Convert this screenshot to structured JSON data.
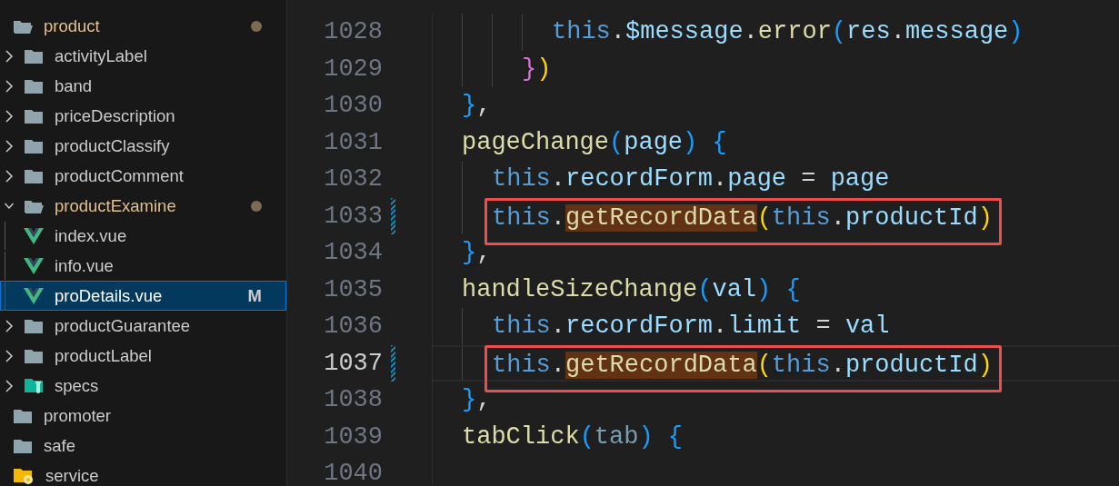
{
  "explorer": {
    "items": [
      {
        "label": "product",
        "kind": "folder",
        "expanded": true,
        "modified": true,
        "selected": false,
        "children": [
          {
            "label": "activityLabel",
            "kind": "folder",
            "expanded": false,
            "modified": false,
            "selected": false
          },
          {
            "label": "band",
            "kind": "folder",
            "expanded": false,
            "modified": false,
            "selected": false
          },
          {
            "label": "priceDescription",
            "kind": "folder",
            "expanded": false,
            "modified": false,
            "selected": false
          },
          {
            "label": "productClassify",
            "kind": "folder",
            "expanded": false,
            "modified": false,
            "selected": false
          },
          {
            "label": "productComment",
            "kind": "folder",
            "expanded": false,
            "modified": false,
            "selected": false
          },
          {
            "label": "productExamine",
            "kind": "folder",
            "expanded": true,
            "modified": true,
            "selected": false,
            "children": [
              {
                "label": "index.vue",
                "kind": "vue",
                "modified": false,
                "selected": false
              },
              {
                "label": "info.vue",
                "kind": "vue",
                "modified": false,
                "selected": false
              },
              {
                "label": "proDetails.vue",
                "kind": "vue",
                "modified": false,
                "selected": true,
                "badge": "M"
              }
            ]
          },
          {
            "label": "productGuarantee",
            "kind": "folder",
            "expanded": false,
            "modified": false,
            "selected": false
          },
          {
            "label": "productLabel",
            "kind": "folder",
            "expanded": false,
            "modified": false,
            "selected": false
          },
          {
            "label": "specs",
            "kind": "folder-test",
            "expanded": false,
            "modified": false,
            "selected": false
          }
        ]
      },
      {
        "label": "promoter",
        "kind": "folder",
        "expanded": false,
        "modified": false,
        "selected": false
      },
      {
        "label": "safe",
        "kind": "folder",
        "expanded": false,
        "modified": false,
        "selected": false
      },
      {
        "label": "service",
        "kind": "folder-service",
        "expanded": false,
        "modified": false,
        "selected": false
      }
    ]
  },
  "editor": {
    "lines": [
      {
        "number": "1028",
        "current": false,
        "changed": false,
        "boxed": false,
        "tokens": [
          {
            "text": "      this",
            "kind": "keyword"
          },
          {
            "text": ".",
            "kind": "punct"
          },
          {
            "text": "$message",
            "kind": "prop"
          },
          {
            "text": ".",
            "kind": "punct"
          },
          {
            "text": "error",
            "kind": "func"
          },
          {
            "text": "(",
            "kind": "bracket3"
          },
          {
            "text": "res",
            "kind": "prop"
          },
          {
            "text": ".",
            "kind": "punct"
          },
          {
            "text": "message",
            "kind": "prop"
          },
          {
            "text": ")",
            "kind": "bracket3"
          }
        ]
      },
      {
        "number": "1029",
        "current": false,
        "changed": false,
        "boxed": false,
        "tokens": [
          {
            "text": "    }",
            "kind": "bracket2"
          },
          {
            "text": ")",
            "kind": "bracket1"
          }
        ]
      },
      {
        "number": "1030",
        "current": false,
        "changed": false,
        "boxed": false,
        "tokens": [
          {
            "text": "}",
            "kind": "bracket3"
          },
          {
            "text": ",",
            "kind": "punct"
          }
        ]
      },
      {
        "number": "1031",
        "current": false,
        "changed": false,
        "boxed": false,
        "tokens": [
          {
            "text": "pageChange",
            "kind": "func"
          },
          {
            "text": "(",
            "kind": "bracket3"
          },
          {
            "text": "page",
            "kind": "prop"
          },
          {
            "text": ")",
            "kind": "bracket3"
          },
          {
            "text": " {",
            "kind": "bracket3"
          }
        ]
      },
      {
        "number": "1032",
        "current": false,
        "changed": false,
        "boxed": false,
        "tokens": [
          {
            "text": "  this",
            "kind": "keyword"
          },
          {
            "text": ".",
            "kind": "punct"
          },
          {
            "text": "recordForm",
            "kind": "prop"
          },
          {
            "text": ".",
            "kind": "punct"
          },
          {
            "text": "page",
            "kind": "prop"
          },
          {
            "text": " = ",
            "kind": "punct"
          },
          {
            "text": "page",
            "kind": "prop"
          }
        ]
      },
      {
        "number": "1033",
        "current": false,
        "changed": true,
        "boxed": true,
        "tokens": [
          {
            "text": "  this",
            "kind": "keyword"
          },
          {
            "text": ".",
            "kind": "punct"
          },
          {
            "text": "getRecordData",
            "kind": "func-match"
          },
          {
            "text": "(",
            "kind": "bracket1"
          },
          {
            "text": "this",
            "kind": "keyword"
          },
          {
            "text": ".",
            "kind": "punct"
          },
          {
            "text": "productId",
            "kind": "prop"
          },
          {
            "text": ")",
            "kind": "bracket1"
          }
        ]
      },
      {
        "number": "1034",
        "current": false,
        "changed": false,
        "boxed": false,
        "tokens": [
          {
            "text": "}",
            "kind": "bracket3"
          },
          {
            "text": ",",
            "kind": "punct"
          }
        ]
      },
      {
        "number": "1035",
        "current": false,
        "changed": false,
        "boxed": false,
        "tokens": [
          {
            "text": "handleSizeChange",
            "kind": "func"
          },
          {
            "text": "(",
            "kind": "bracket3"
          },
          {
            "text": "val",
            "kind": "prop"
          },
          {
            "text": ")",
            "kind": "bracket3"
          },
          {
            "text": " {",
            "kind": "bracket3"
          }
        ]
      },
      {
        "number": "1036",
        "current": false,
        "changed": false,
        "boxed": false,
        "tokens": [
          {
            "text": "  this",
            "kind": "keyword"
          },
          {
            "text": ".",
            "kind": "punct"
          },
          {
            "text": "recordForm",
            "kind": "prop"
          },
          {
            "text": ".",
            "kind": "punct"
          },
          {
            "text": "limit",
            "kind": "prop"
          },
          {
            "text": " = ",
            "kind": "punct"
          },
          {
            "text": "val",
            "kind": "prop"
          }
        ]
      },
      {
        "number": "1037",
        "current": true,
        "changed": true,
        "boxed": true,
        "tokens": [
          {
            "text": "  this",
            "kind": "keyword"
          },
          {
            "text": ".",
            "kind": "punct"
          },
          {
            "text": "getRecordData",
            "kind": "func-match"
          },
          {
            "text": "(",
            "kind": "bracket1"
          },
          {
            "text": "this",
            "kind": "keyword"
          },
          {
            "text": ".",
            "kind": "punct"
          },
          {
            "text": "productId",
            "kind": "prop"
          },
          {
            "text": ")",
            "kind": "bracket1"
          }
        ]
      },
      {
        "number": "1038",
        "current": false,
        "changed": false,
        "boxed": false,
        "tokens": [
          {
            "text": "}",
            "kind": "bracket3"
          },
          {
            "text": ",",
            "kind": "punct"
          }
        ]
      },
      {
        "number": "1039",
        "current": false,
        "changed": false,
        "boxed": false,
        "tokens": [
          {
            "text": "tabClick",
            "kind": "func"
          },
          {
            "text": "(",
            "kind": "bracket3"
          },
          {
            "text": "tab",
            "kind": "unused"
          },
          {
            "text": ")",
            "kind": "bracket3"
          },
          {
            "text": " {",
            "kind": "bracket3"
          }
        ]
      },
      {
        "number": "1040",
        "current": false,
        "changed": false
      }
    ]
  }
}
